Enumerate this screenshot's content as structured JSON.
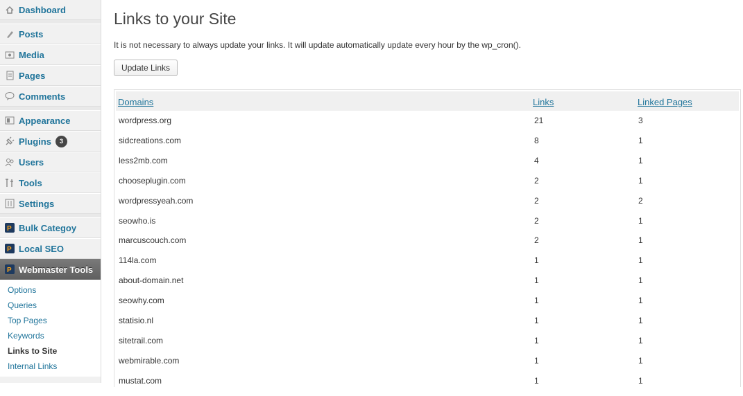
{
  "sidebar": {
    "items": [
      {
        "label": "Dashboard",
        "icon": "dashboard-icon"
      },
      {
        "label": "Posts",
        "icon": "posts-icon"
      },
      {
        "label": "Media",
        "icon": "media-icon"
      },
      {
        "label": "Pages",
        "icon": "pages-icon"
      },
      {
        "label": "Comments",
        "icon": "comments-icon"
      },
      {
        "label": "Appearance",
        "icon": "appearance-icon"
      },
      {
        "label": "Plugins",
        "icon": "plugins-icon",
        "badge": "3"
      },
      {
        "label": "Users",
        "icon": "users-icon"
      },
      {
        "label": "Tools",
        "icon": "tools-icon"
      },
      {
        "label": "Settings",
        "icon": "settings-icon"
      },
      {
        "label": "Bulk Categoy",
        "icon": "plugin-logo-icon"
      },
      {
        "label": "Local SEO",
        "icon": "plugin-logo-icon"
      },
      {
        "label": "Webmaster Tools",
        "icon": "plugin-logo-icon",
        "active": true
      }
    ],
    "submenu": [
      "Options",
      "Queries",
      "Top Pages",
      "Keywords",
      "Links to Site",
      "Internal Links"
    ],
    "submenu_current": "Links to Site"
  },
  "main": {
    "title": "Links to your Site",
    "notice": "It is not necessary to always update your links. It will update automatically update every hour by the wp_cron().",
    "update_button": "Update Links"
  },
  "table": {
    "headers": [
      "Domains",
      "Links",
      "Linked Pages"
    ],
    "rows": [
      [
        "wordpress.org",
        "21",
        "3"
      ],
      [
        "sidcreations.com",
        "8",
        "1"
      ],
      [
        "less2mb.com",
        "4",
        "1"
      ],
      [
        "chooseplugin.com",
        "2",
        "1"
      ],
      [
        "wordpressyeah.com",
        "2",
        "2"
      ],
      [
        "seowho.is",
        "2",
        "1"
      ],
      [
        "marcuscouch.com",
        "2",
        "1"
      ],
      [
        "114la.com",
        "1",
        "1"
      ],
      [
        "about-domain.net",
        "1",
        "1"
      ],
      [
        "seowhy.com",
        "1",
        "1"
      ],
      [
        "statisio.nl",
        "1",
        "1"
      ],
      [
        "sitetrail.com",
        "1",
        "1"
      ],
      [
        "webmirable.com",
        "1",
        "1"
      ],
      [
        "mustat.com",
        "1",
        "1"
      ]
    ]
  },
  "colors": {
    "link": "#21759b",
    "active_menu": "#6d6d6d",
    "sidebar_bg": "#f1f1f1"
  }
}
